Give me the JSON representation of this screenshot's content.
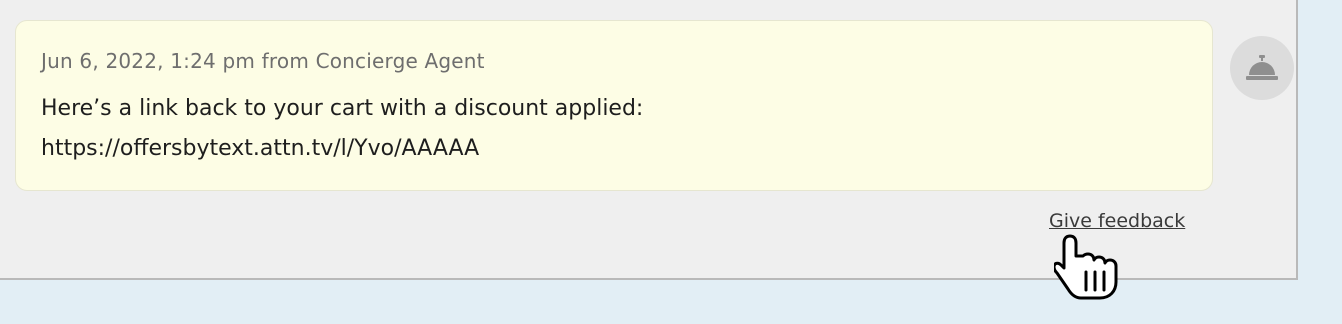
{
  "message": {
    "meta": "Jun 6, 2022, 1:24 pm from Concierge Agent",
    "lines": [
      "Here’s a link back to your cart with a discount applied:",
      "https://offersbytext.attn.tv/l/Yvo/AAAAA"
    ]
  },
  "avatar": {
    "icon": "concierge-bell-icon"
  },
  "feedback": {
    "label": "Give feedback"
  },
  "cursor": {
    "icon": "hand-pointer-icon"
  },
  "colors": {
    "bubble": "#fdfde5",
    "panel": "#efefef",
    "page_background": "#e2eef5",
    "avatar_background": "#dcdcdc"
  }
}
